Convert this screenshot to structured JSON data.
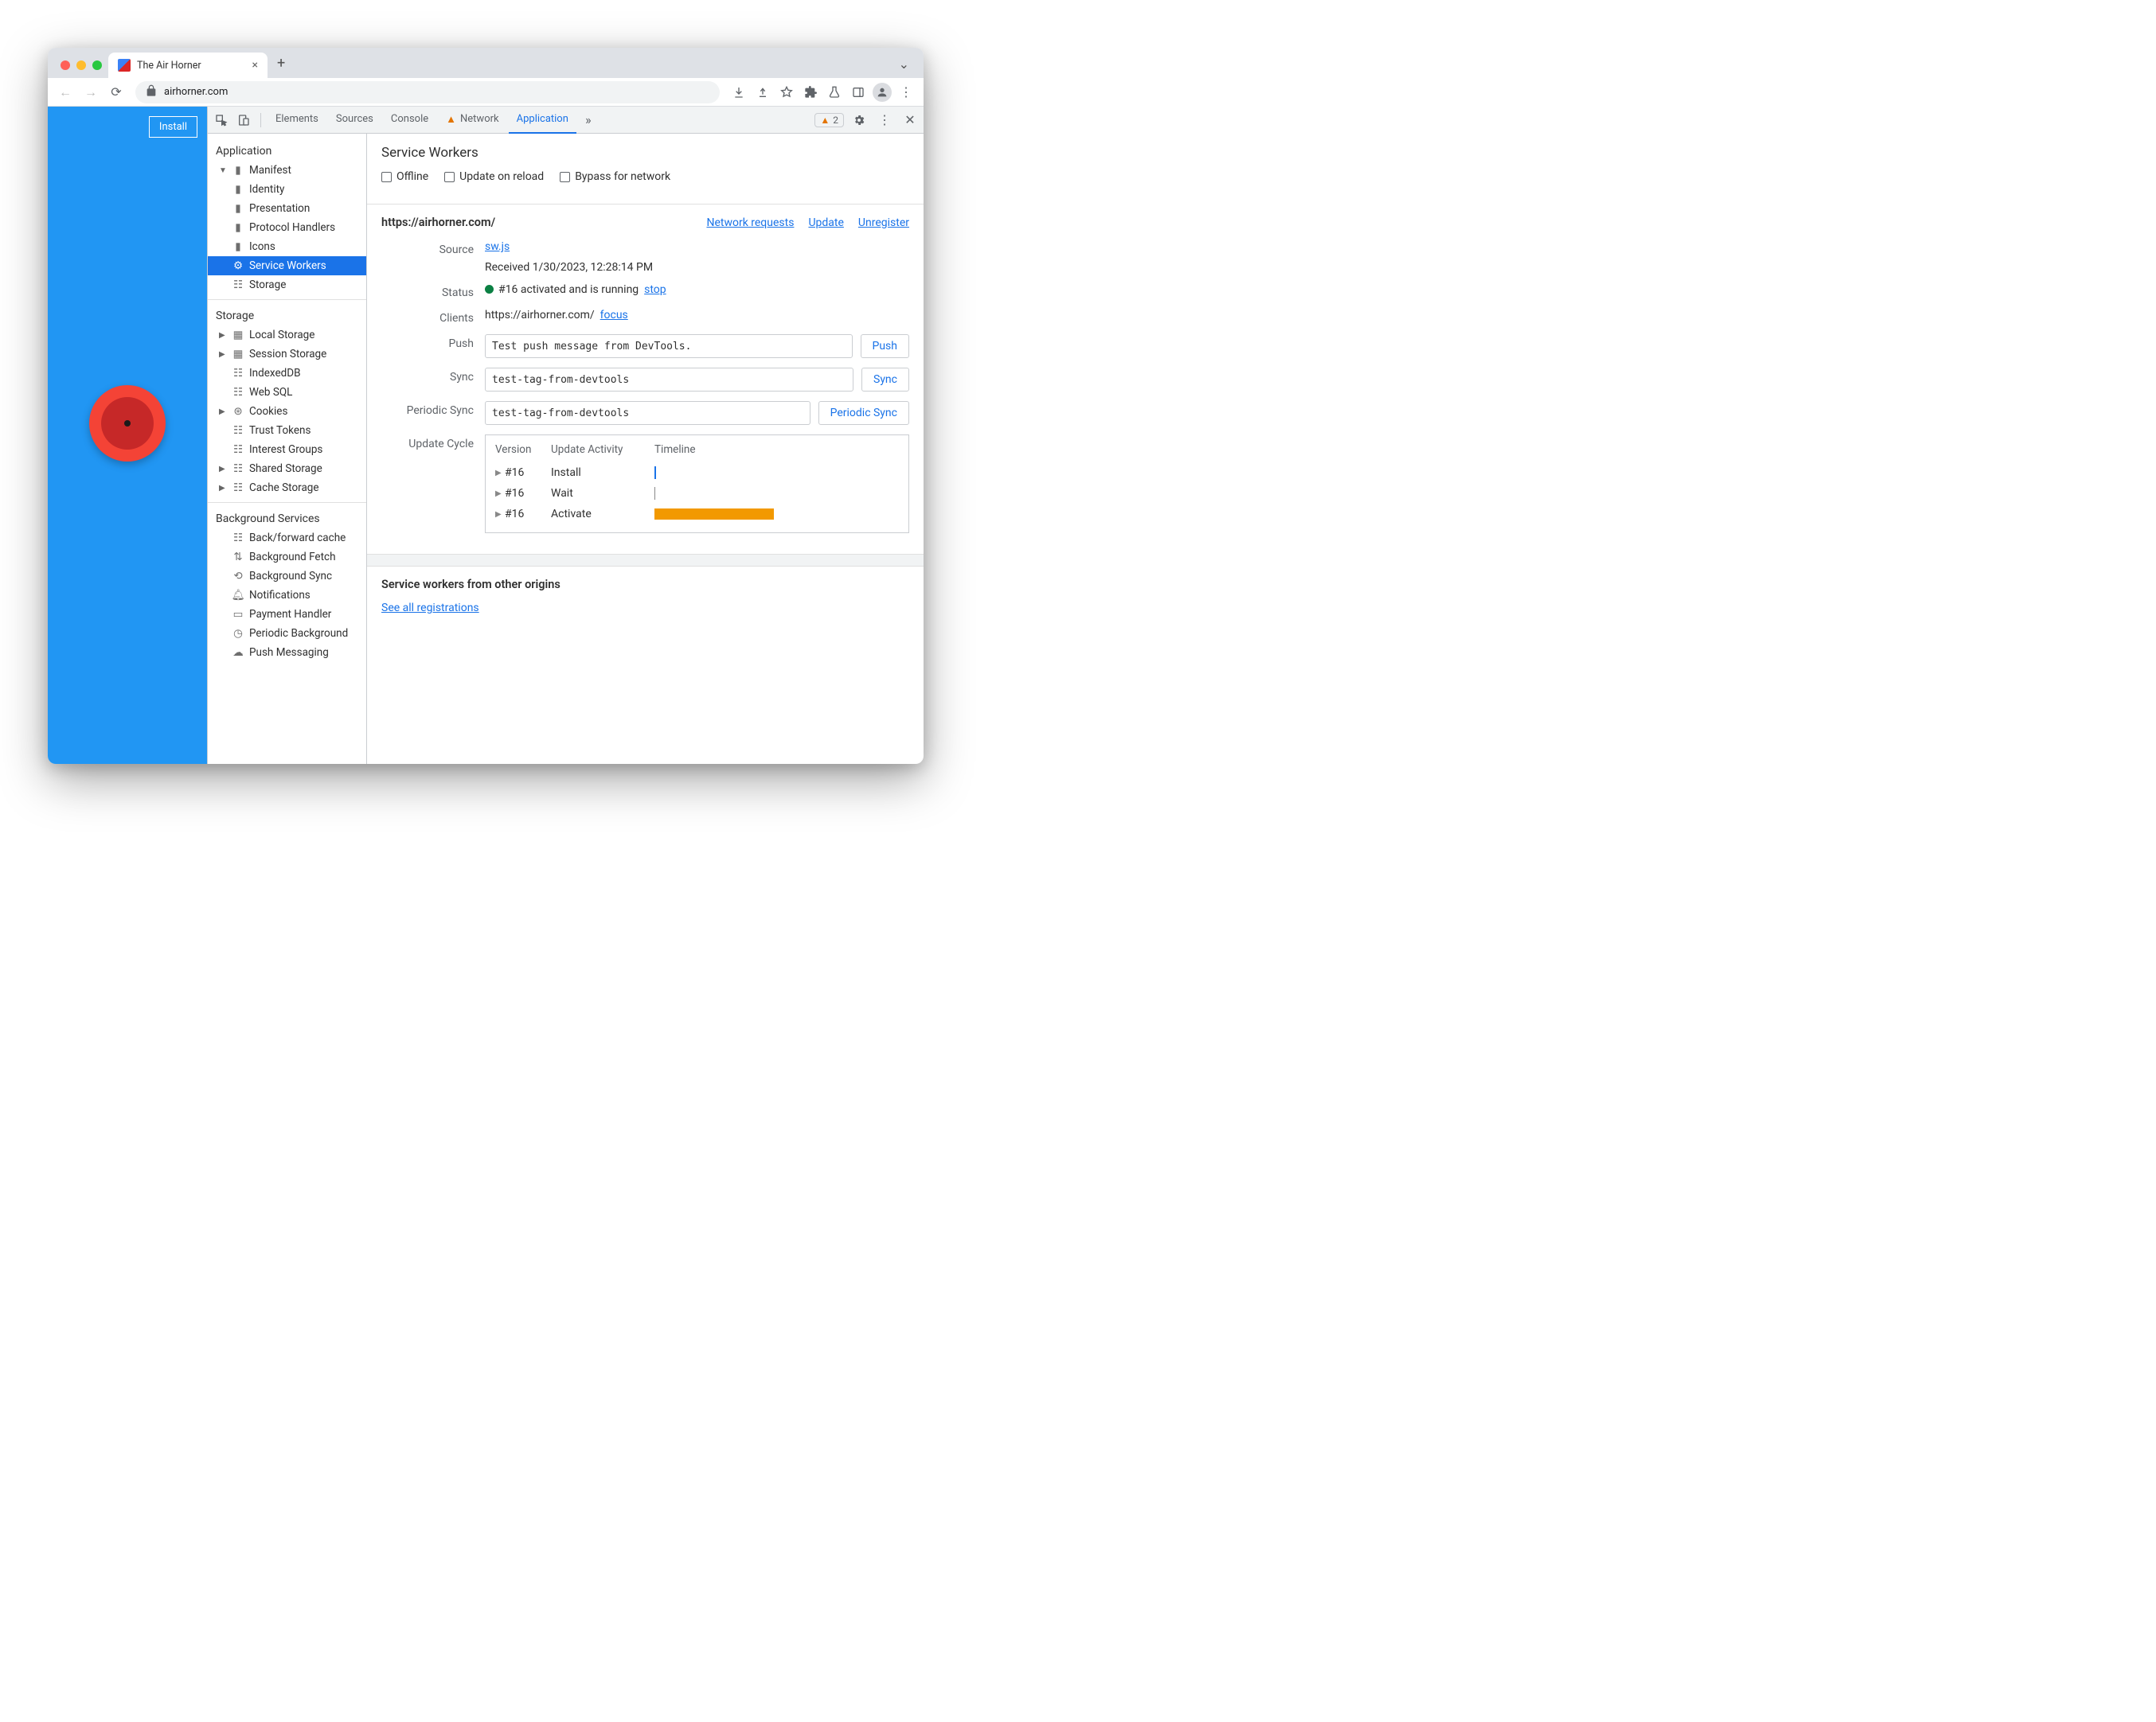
{
  "browser": {
    "tab_title": "The Air Horner",
    "url_display": "airhorner.com"
  },
  "page": {
    "install_btn": "Install"
  },
  "devtools": {
    "tabs": {
      "elements": "Elements",
      "sources": "Sources",
      "console": "Console",
      "network": "Network",
      "application": "Application"
    },
    "warn_count": "2"
  },
  "sidebar": {
    "application": "Application",
    "manifest": "Manifest",
    "identity": "Identity",
    "presentation": "Presentation",
    "protocol_handlers": "Protocol Handlers",
    "icons": "Icons",
    "service_workers": "Service Workers",
    "storage": "Storage",
    "storage_sec": "Storage",
    "local_storage": "Local Storage",
    "session_storage": "Session Storage",
    "indexeddb": "IndexedDB",
    "web_sql": "Web SQL",
    "cookies": "Cookies",
    "trust_tokens": "Trust Tokens",
    "interest_groups": "Interest Groups",
    "shared_storage": "Shared Storage",
    "cache_storage": "Cache Storage",
    "bg_sec": "Background Services",
    "bf_cache": "Back/forward cache",
    "bg_fetch": "Background Fetch",
    "bg_sync": "Background Sync",
    "notifications": "Notifications",
    "payment_handler": "Payment Handler",
    "periodic_bg": "Periodic Background",
    "push_msg": "Push Messaging"
  },
  "sw": {
    "title": "Service Workers",
    "chk_offline": "Offline",
    "chk_reload": "Update on reload",
    "chk_bypass": "Bypass for network",
    "origin": "https://airhorner.com/",
    "link_netreq": "Network requests",
    "link_update": "Update",
    "link_unreg": "Unregister",
    "label_source": "Source",
    "source_file": "sw.js",
    "received": "Received 1/30/2023, 12:28:14 PM",
    "label_status": "Status",
    "status_text": "#16 activated and is running",
    "stop": "stop",
    "label_clients": "Clients",
    "client_url": "https://airhorner.com/",
    "focus": "focus",
    "label_push": "Push",
    "push_val": "Test push message from DevTools.",
    "push_btn": "Push",
    "label_sync": "Sync",
    "sync_val": "test-tag-from-devtools",
    "sync_btn": "Sync",
    "label_psync": "Periodic Sync",
    "psync_val": "test-tag-from-devtools",
    "psync_btn": "Periodic Sync",
    "label_cycle": "Update Cycle",
    "col_version": "Version",
    "col_activity": "Update Activity",
    "col_timeline": "Timeline",
    "row_install": {
      "v": "#16",
      "a": "Install"
    },
    "row_wait": {
      "v": "#16",
      "a": "Wait"
    },
    "row_activate": {
      "v": "#16",
      "a": "Activate"
    },
    "other_title": "Service workers from other origins",
    "see_all": "See all registrations"
  }
}
